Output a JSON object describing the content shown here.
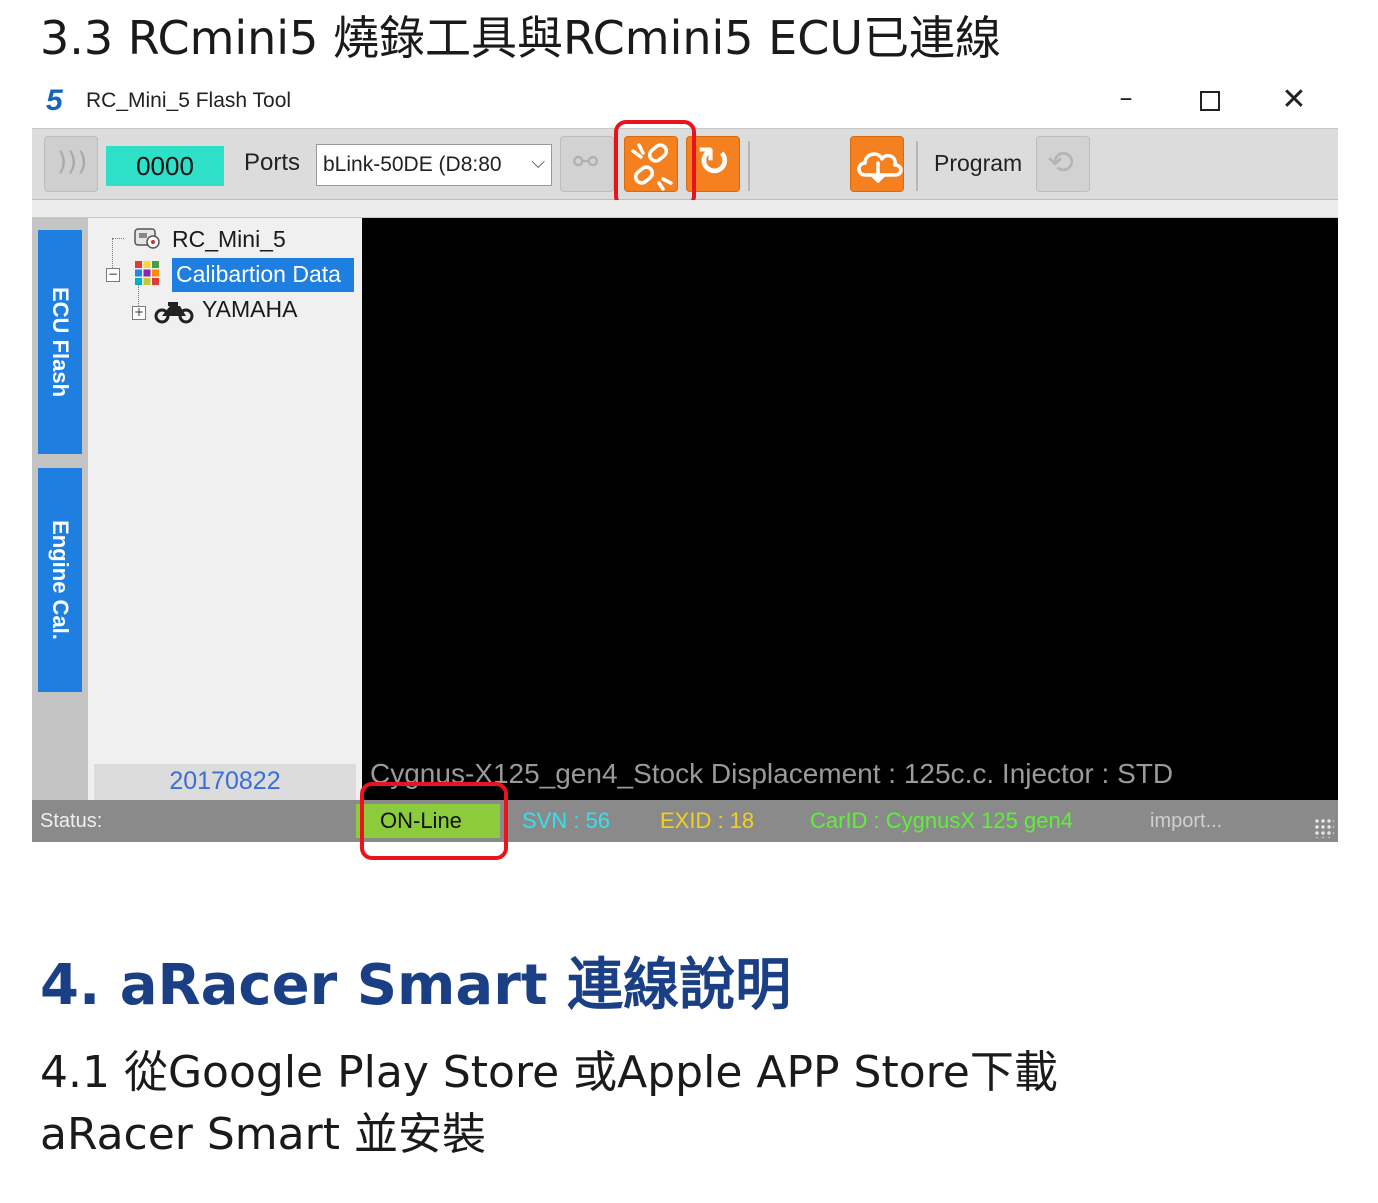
{
  "doc": {
    "heading_3_3": "3.3 RCmini5 燒錄工具與RCmini5 ECU已連線",
    "heading_4": "4. aRacer Smart 連線說明",
    "heading_4_1_line1": "4.1 從Google Play Store 或Apple APP Store下載",
    "heading_4_1_line2": "aRacer Smart 並安裝"
  },
  "window": {
    "logo": "5",
    "title": "RC_Mini_5 Flash Tool",
    "controls": {
      "minimize": "–",
      "close": "✕"
    }
  },
  "toolbar": {
    "counter": "0000",
    "ports_label": "Ports",
    "ports_value": "bLink-50DE (D8:80",
    "program_label": "Program",
    "icons": [
      "wireless-icon",
      "link-icon",
      "unlink-icon",
      "refresh-icon",
      "cloud-download-icon",
      "program-icon"
    ],
    "accent_color": "#f5801f"
  },
  "sidebar": {
    "tabs": [
      {
        "label": "ECU Flash"
      },
      {
        "label": "Engine Cal."
      }
    ]
  },
  "tree": {
    "items": [
      {
        "label": "RC_Mini_5"
      },
      {
        "label": "Calibartion Data",
        "selected": true
      },
      {
        "label": "YAMAHA"
      }
    ],
    "date": "20170822"
  },
  "main": {
    "info": "Cygnus-X125_gen4_Stock   Displacement : 125c.c.  Injector : STD"
  },
  "status": {
    "label": "Status:",
    "state": "ON-Line",
    "svn": "SVN : 56",
    "exid": "EXID : 18",
    "carid": "CarID : CygnusX 125 gen4",
    "import": "import..."
  },
  "annotations": {
    "highlight_color": "#e8131b"
  }
}
